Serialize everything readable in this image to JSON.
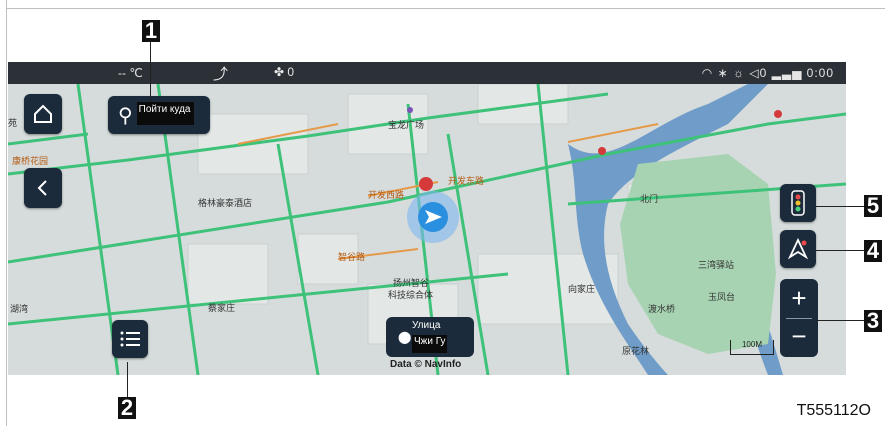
{
  "status_bar": {
    "temperature": "-- ℃",
    "seat_heat_icon": "seat-heat-icon",
    "fan_icon": "fan-icon",
    "fan_level": "0",
    "wifi_icon": "wifi-icon",
    "bluetooth_icon": "bluetooth-icon",
    "brightness_icon": "brightness-icon",
    "volume_icon": "volume-icon",
    "volume_level": "0",
    "signal_icon": "signal-icon",
    "time": "0:00"
  },
  "search": {
    "label": "Пойти куда"
  },
  "current_street": {
    "line1": "Улица",
    "line2": "Чжи Гу"
  },
  "map": {
    "copyright": "Data © NavInfo",
    "scale": "100M",
    "labels": {
      "l1": "宝龙广场",
      "l2": "开发西路",
      "l3": "开发东路",
      "l4": "北门",
      "l5": "格林豪泰酒店",
      "l6": "智谷路",
      "l7": "扬州智谷",
      "l8": "科技综合体",
      "l9": "蔡家庄",
      "l10": "向家庄",
      "l11": "三湾驿站",
      "l12": "玉凤台",
      "l13": "康桥花园",
      "l14": "渡水桥",
      "l15": "原花林",
      "l16": "湖湾",
      "l17": "苑"
    }
  },
  "callouts": {
    "c1": "1",
    "c2": "2",
    "c3": "3",
    "c4": "4",
    "c5": "5"
  },
  "figure_ref": "T555112O",
  "colors": {
    "button_bg": "#1c2b3c",
    "status_bar_bg": "#2c3138",
    "map_bg": "#d5dcdb",
    "road_green": "#3ec27a",
    "road_orange": "#e59a4a",
    "water": "#6f9cc8",
    "park": "#a7d3b2",
    "vehicle_marker": "#2b8fe0"
  }
}
